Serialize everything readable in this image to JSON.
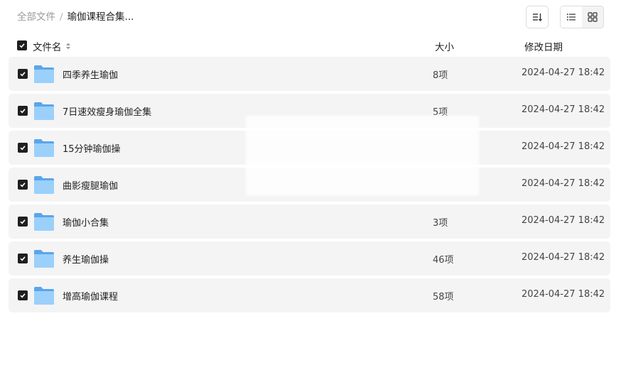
{
  "breadcrumb": {
    "root": "全部文件",
    "separator": "/",
    "current": "瑜伽课程合集..."
  },
  "toolbar": {
    "sort_icon": "sort-desc-icon",
    "list_view_icon": "list-view-icon",
    "grid_view_icon": "grid-view-icon",
    "active_view": "list"
  },
  "header": {
    "name": "文件名",
    "size": "大小",
    "date": "修改日期"
  },
  "colors": {
    "row_bg": "#f4f4f5",
    "checkbox": "#1f1f1f",
    "folder": "#7fbdf2"
  },
  "files": [
    {
      "name": "四季养生瑜伽",
      "size": "8项",
      "date": "2024-04-27 18:42"
    },
    {
      "name": "7日速效瘦身瑜伽全集",
      "size": "5项",
      "date": "2024-04-27 18:42"
    },
    {
      "name": "15分钟瑜伽操",
      "size": "",
      "date": "2024-04-27 18:42"
    },
    {
      "name": "曲影瘦腿瑜伽",
      "size": "",
      "date": "2024-04-27 18:42"
    },
    {
      "name": "瑜伽小合集",
      "size": "3项",
      "date": "2024-04-27 18:42"
    },
    {
      "name": "养生瑜伽操",
      "size": "46项",
      "date": "2024-04-27 18:42"
    },
    {
      "name": "增高瑜伽课程",
      "size": "58项",
      "date": "2024-04-27 18:42"
    }
  ]
}
